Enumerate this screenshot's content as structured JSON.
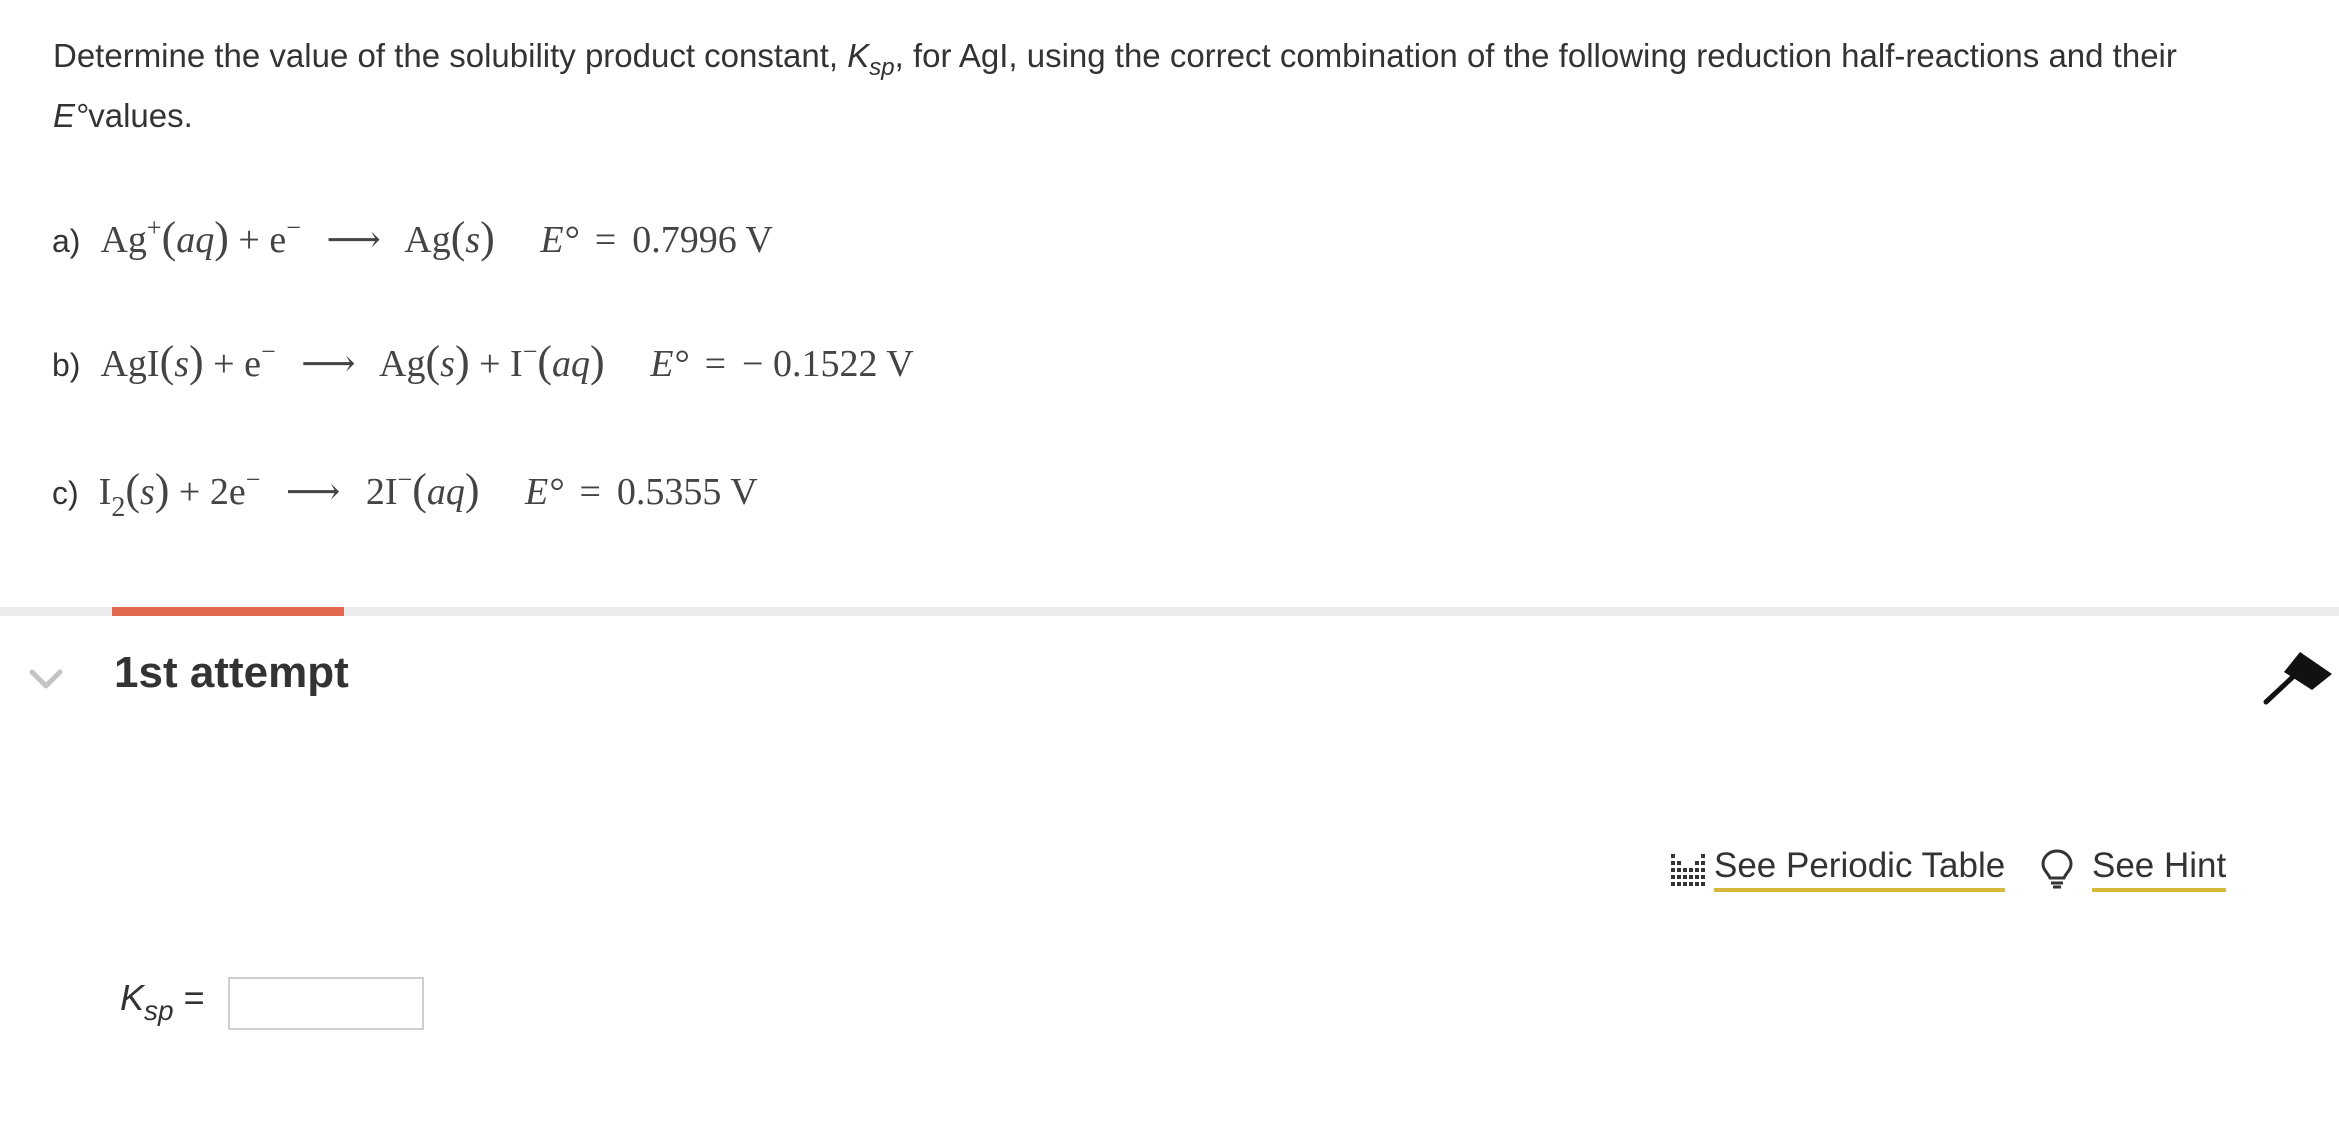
{
  "question": {
    "text_1": "Determine the value of the solubility product constant, ",
    "ksp_symbol": "K",
    "ksp_subscript": "sp",
    "text_2": ", for AgI, using the correct combination of the following reduction half-reactions and their ",
    "e_symbol": "E°",
    "text_3": "values."
  },
  "reactions": [
    {
      "label": "a)",
      "lhs_species": "Ag",
      "lhs_charge": "+",
      "lhs_state": "aq",
      "plus": "+",
      "electron": "e",
      "electron_charge": "−",
      "rhs_species": "Ag",
      "rhs_state": "s",
      "e_label": "E°",
      "equals": "=",
      "potential": "0.7996 V"
    },
    {
      "label": "b)",
      "lhs_species": "AgI",
      "lhs_state": "s",
      "plus": "+",
      "electron": "e",
      "electron_charge": "−",
      "rhs_species": "Ag",
      "rhs_state": "s",
      "rhs_plus": "+",
      "rhs_species_2": "I",
      "rhs_charge_2": "−",
      "rhs_state_2": "aq",
      "e_label": "E°",
      "equals": "=",
      "potential": "− 0.1522 V"
    },
    {
      "label": "c)",
      "lhs_species": "I",
      "lhs_subscript": "2",
      "lhs_state": "s",
      "plus": "+",
      "electron_coeff": "2e",
      "electron_charge": "−",
      "rhs_coeff_species": "2I",
      "rhs_charge": "−",
      "rhs_state": "aq",
      "e_label": "E°",
      "equals": "=",
      "potential": "0.5355 V"
    }
  ],
  "attempt": {
    "title": "1st attempt",
    "progress_fraction": 0.066
  },
  "tools": {
    "periodic_table_label": "See Periodic Table",
    "hint_label": "See Hint",
    "periodic_icon": "periodic-table-icon",
    "hint_icon": "lightbulb-icon"
  },
  "answer": {
    "label_symbol": "K",
    "label_subscript": "sp",
    "label_equals": " =",
    "value": "",
    "placeholder": ""
  },
  "colors": {
    "progress_accent": "#e0694e",
    "link_underline": "#d4b93c",
    "text": "#333333"
  }
}
